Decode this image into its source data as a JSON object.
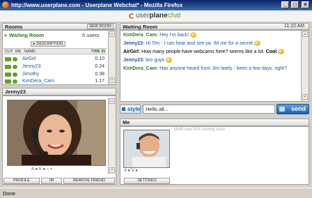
{
  "window": {
    "title": "http://www.userplane.com - Userplane Webchat* - Mozilla Firefox",
    "min_glyph": "_",
    "max_glyph": "□",
    "close_glyph": "×"
  },
  "brand": {
    "prefix": "user",
    "middle": "plane",
    "suffix": "chat"
  },
  "rooms": {
    "title": "Rooms",
    "new_room_label": "NEW ROOM",
    "current_room": "Waiting Room",
    "user_count": "5 users",
    "description_label": "DESCRIPTION",
    "columns": [
      "CUT",
      "ME",
      "NAME",
      "TIME IN"
    ],
    "users": [
      {
        "name": "AirGirl",
        "time": "0.10"
      },
      {
        "name": "Jenny23",
        "time": "0.24"
      },
      {
        "name": "Jimothy",
        "time": "0.38"
      },
      {
        "name": "KimDera_Cam",
        "time": "1.17"
      }
    ]
  },
  "jenny": {
    "title": "Jenny23",
    "av_controls": "A ● V ● − +",
    "profile_label": "PROFILE",
    "im_label": "IM",
    "remove_friend_label": "REMOVE FRIEND"
  },
  "chat": {
    "room_title": "Waiting Room",
    "time": "11:22 AM",
    "messages": [
      {
        "who": "KimDera_Cam:",
        "text": " Hey I'm back!",
        "color": "g",
        "smiley": true
      },
      {
        "who": "Jenny23:",
        "text": " Hi Tim - I can hear and see ya. IM me for a secret",
        "color": "b",
        "smiley": true
      },
      {
        "who": "AirGirl:",
        "text": " How many people have webcams here? seems like a lot. ",
        "color": "k",
        "tail": "Cool",
        "smiley": true
      },
      {
        "who": "Jenny23:",
        "text": " bro guys",
        "color": "b",
        "smiley": true
      },
      {
        "who": "KimDera_Cam:",
        "text": " Has anyone heard from Jim lately - been a few days. right?",
        "color": "g",
        "smiley": false
      }
    ],
    "style_label": "style",
    "input_value": "Hello all...",
    "send_label": "send"
  },
  "me": {
    "title": "Me",
    "multi_note": "Multi-user A/V coming soon",
    "av_controls": "A ● V ●",
    "settings_label": "SETTINGS"
  },
  "status": {
    "text": "Done"
  }
}
